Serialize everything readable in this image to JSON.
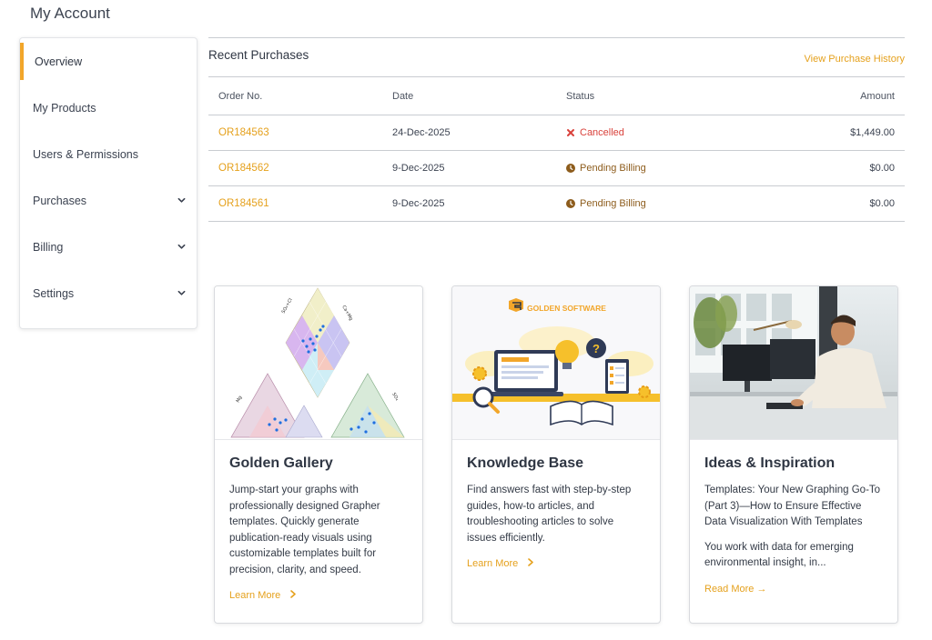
{
  "page": {
    "title": "My Account"
  },
  "sidebar": {
    "items": [
      {
        "label": "Overview",
        "active": true,
        "expandable": false
      },
      {
        "label": "My Products",
        "expandable": false
      },
      {
        "label": "Users & Permissions",
        "expandable": false
      },
      {
        "label": "Purchases",
        "expandable": true,
        "icon": "chevron-down-icon"
      },
      {
        "label": "Billing",
        "expandable": true,
        "icon": "chevron-down-icon"
      },
      {
        "label": "Settings",
        "expandable": true,
        "icon": "chevron-down-icon"
      }
    ]
  },
  "purchases": {
    "title": "Recent Purchases",
    "history_link": "View Purchase History",
    "columns": [
      "Order No.",
      "Date",
      "Status",
      "Amount"
    ],
    "rows": [
      {
        "order": "OR184563",
        "date": "24-Dec-2025",
        "status": "Cancelled",
        "status_icon": "x-icon",
        "amount": "$1,449.00"
      },
      {
        "order": "OR184562",
        "date": "9-Dec-2025",
        "status": "Pending Billing",
        "status_icon": "clock-icon",
        "amount": "$0.00"
      },
      {
        "order": "OR184561",
        "date": "9-Dec-2025",
        "status": "Pending Billing",
        "status_icon": "clock-icon",
        "amount": "$0.00"
      }
    ]
  },
  "cards": [
    {
      "title": "Golden Gallery",
      "text": "Jump-start your graphs with professionally designed Grapher templates. Quickly generate publication-ready visuals using customizable templates built for precision, clarity, and speed.",
      "link": "Learn More",
      "image": "ternary-piper-diagram-illustration"
    },
    {
      "title": "Knowledge Base",
      "text": "Find answers fast with step-by-step guides, how-to articles, and troubleshooting articles to solve issues efficiently.",
      "link": "Learn More",
      "image": "knowledge-base-illustration",
      "logo_text": "GOLDEN SOFTWARE"
    },
    {
      "title": "Ideas & Inspiration",
      "text": "Templates: Your New Graphing Go-To (Part 3)—How to Ensure Effective Data Visualization With Templates",
      "text2": "You work with data for emerging environmental insight, in...",
      "link": "Read More →",
      "image": "man-at-desk-photo"
    }
  ],
  "colors": {
    "accent": "#f2a62a",
    "link": "#e5a11d",
    "cancelled": "#d9413b",
    "pending": "#8d5c1c"
  }
}
